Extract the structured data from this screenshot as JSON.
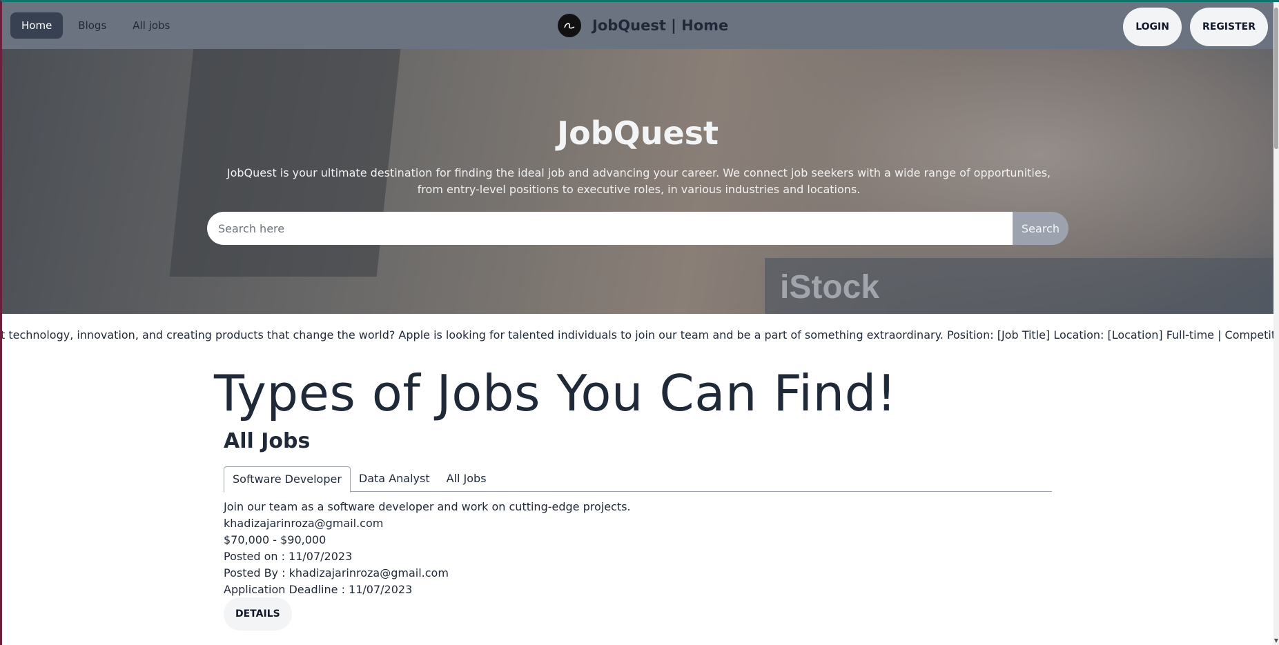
{
  "nav": {
    "links": [
      {
        "label": "Home",
        "active": true
      },
      {
        "label": "Blogs",
        "active": false
      },
      {
        "label": "All jobs",
        "active": false
      }
    ],
    "brand_title": "JobQuest | Home",
    "login_label": "LOGIN",
    "register_label": "REGISTER"
  },
  "hero": {
    "title": "JobQuest",
    "description": "JobQuest is your ultimate destination for finding the ideal job and advancing your career. We connect job seekers with a wide range of opportunities, from entry-level positions to executive roles, in various industries and locations.",
    "search_placeholder": "Search here",
    "search_button": "Search",
    "watermark": "iStock"
  },
  "marquee": {
    "text": "t technology, innovation, and creating products that change the world? Apple is looking for talented individuals to join our team and be a part of something extraordinary. Position: [Job Title] Location: [Location] Full-time | Competitive Salary | Excellent Ben"
  },
  "main": {
    "section_title": "Types of Jobs You Can Find!",
    "all_jobs_heading": "All Jobs",
    "tabs": [
      {
        "label": "Software Developer",
        "active": true
      },
      {
        "label": "Data Analyst",
        "active": false
      },
      {
        "label": "All Jobs",
        "active": false
      }
    ],
    "job": {
      "description": "Join our team as a software developer and work on cutting-edge projects.",
      "email": "khadizajarinroza@gmail.com",
      "salary": "$70,000 - $90,000",
      "posted_on": "Posted on : 11/07/2023",
      "posted_by": "Posted By : khadizajarinroza@gmail.com",
      "deadline": "Application Deadline : 11/07/2023",
      "details_button": "DETAILS"
    }
  },
  "colors": {
    "navbar_bg": "#6b7280",
    "active_nav_bg": "#374151",
    "search_button_bg": "#9ca3af",
    "text_dark": "#1f2937"
  }
}
